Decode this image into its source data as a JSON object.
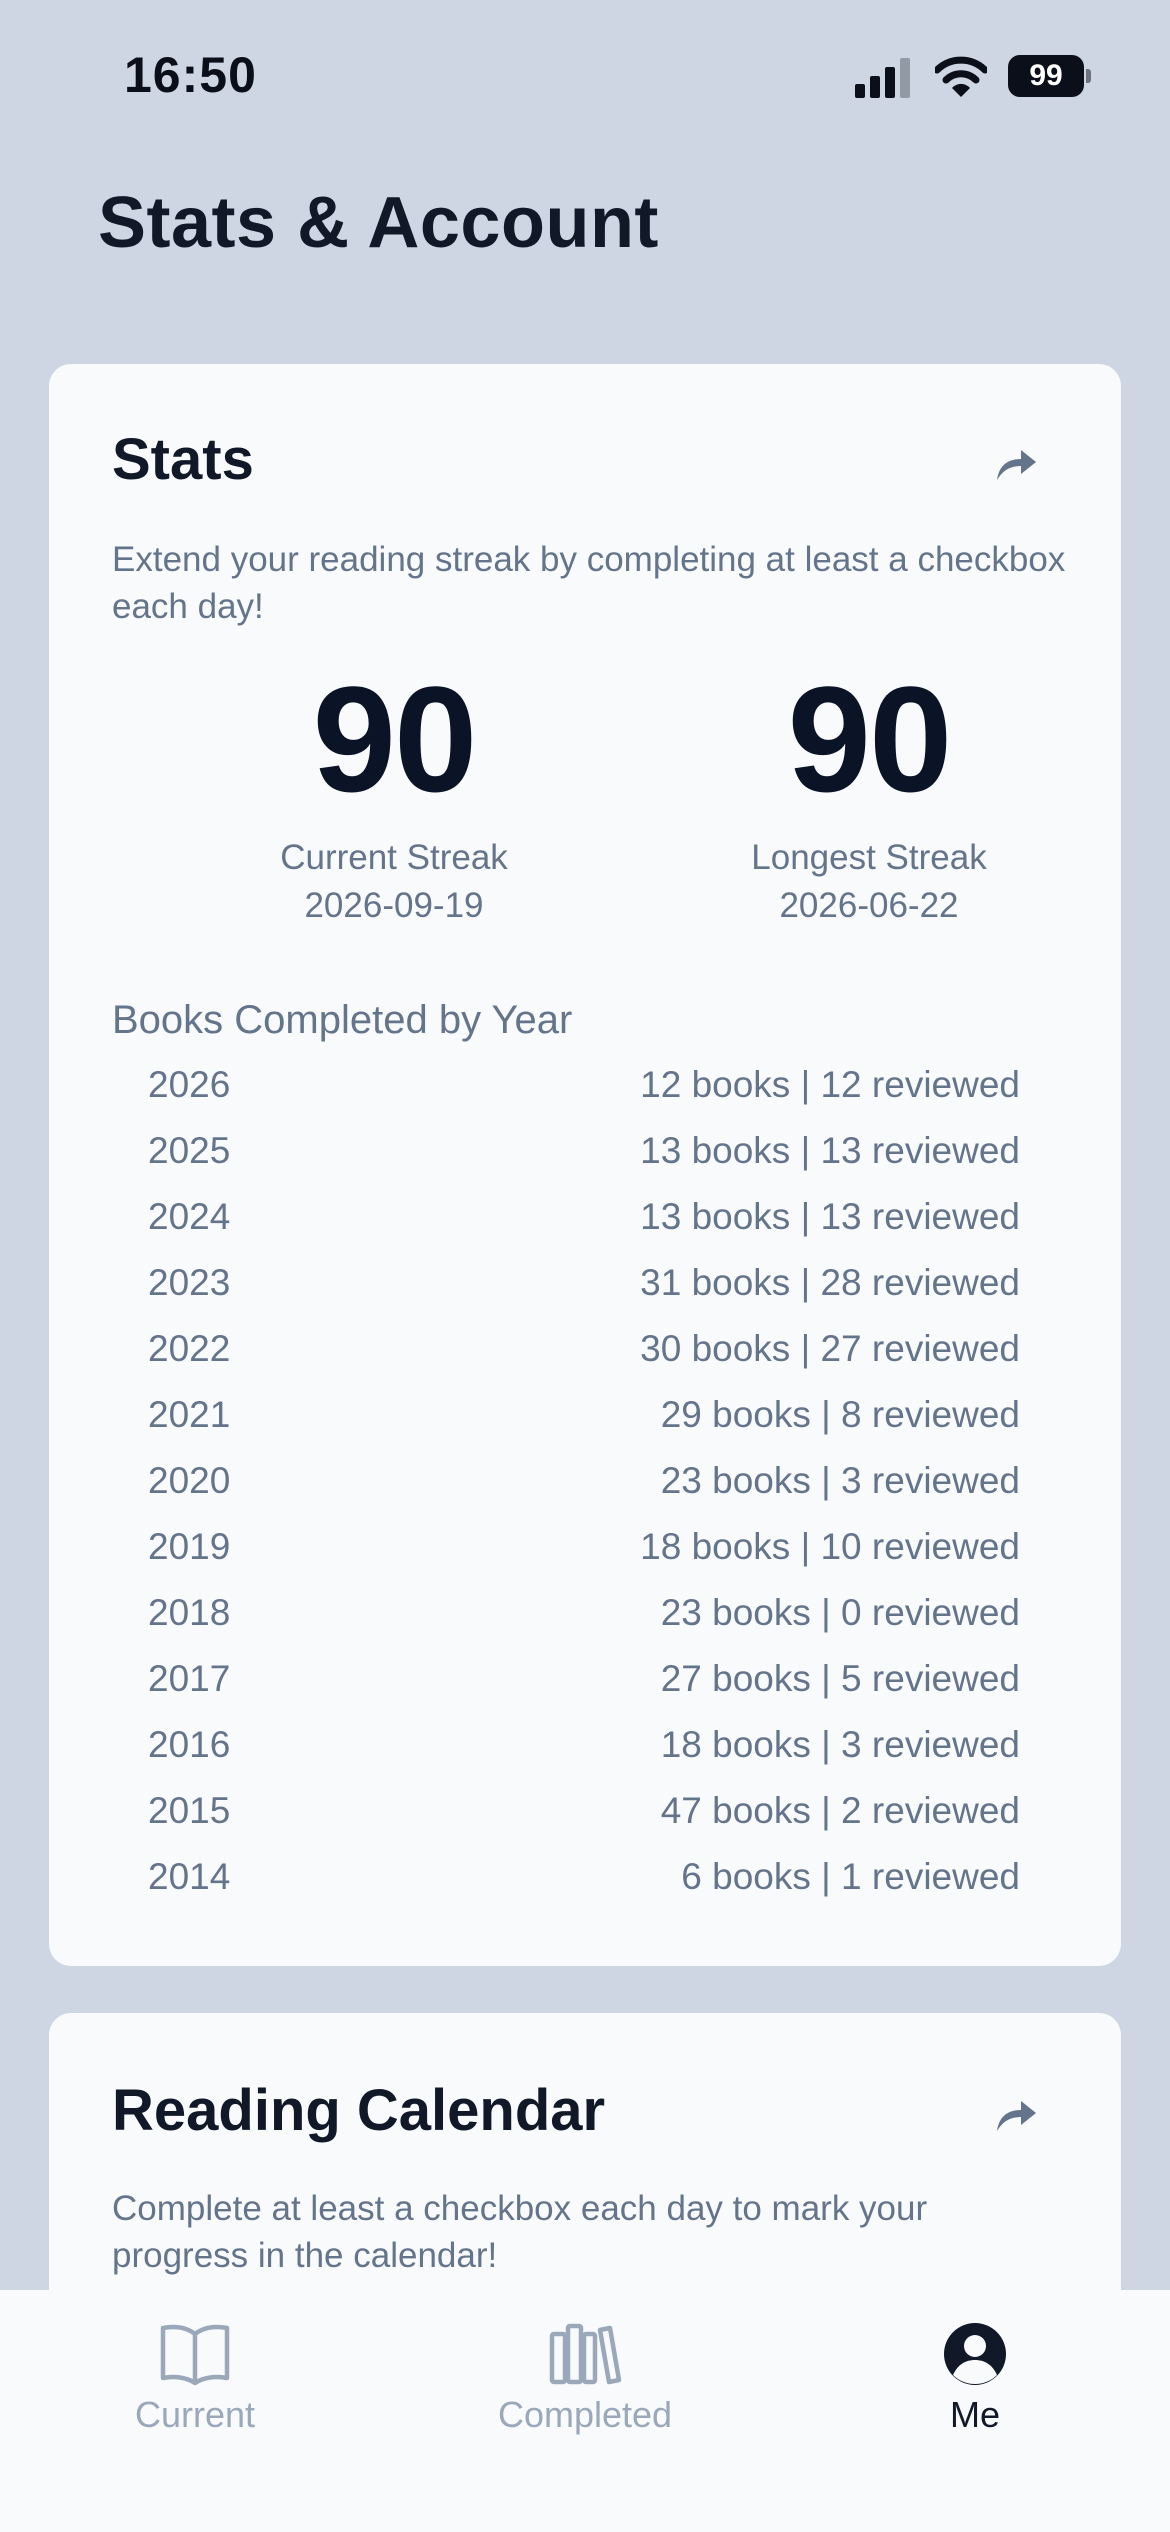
{
  "status": {
    "time": "16:50",
    "battery": "99"
  },
  "page": {
    "title": "Stats & Account"
  },
  "stats": {
    "title": "Stats",
    "description": "Extend your reading streak by completing at least a checkbox each day!",
    "current_streak": {
      "value": "90",
      "label": "Current Streak",
      "date": "2026-09-19"
    },
    "longest_streak": {
      "value": "90",
      "label": "Longest Streak",
      "date": "2026-06-22"
    },
    "years_title": "Books Completed by Year",
    "years": [
      {
        "year": "2026",
        "summary": "12 books | 12 reviewed"
      },
      {
        "year": "2025",
        "summary": "13 books | 13 reviewed"
      },
      {
        "year": "2024",
        "summary": "13 books | 13 reviewed"
      },
      {
        "year": "2023",
        "summary": "31 books | 28 reviewed"
      },
      {
        "year": "2022",
        "summary": "30 books | 27 reviewed"
      },
      {
        "year": "2021",
        "summary": "29 books | 8 reviewed"
      },
      {
        "year": "2020",
        "summary": "23 books | 3 reviewed"
      },
      {
        "year": "2019",
        "summary": "18 books | 10 reviewed"
      },
      {
        "year": "2018",
        "summary": "23 books | 0 reviewed"
      },
      {
        "year": "2017",
        "summary": "27 books | 5 reviewed"
      },
      {
        "year": "2016",
        "summary": "18 books | 3 reviewed"
      },
      {
        "year": "2015",
        "summary": "47 books | 2 reviewed"
      },
      {
        "year": "2014",
        "summary": "6 books | 1 reviewed"
      }
    ]
  },
  "calendar": {
    "title": "Reading Calendar",
    "description": "Complete at least a checkbox each day to mark your progress in the calendar!"
  },
  "tabs": [
    {
      "label": "Current",
      "icon": "open-book-icon",
      "active": false
    },
    {
      "label": "Completed",
      "icon": "bookshelf-icon",
      "active": false
    },
    {
      "label": "Me",
      "icon": "user-circle-icon",
      "active": true
    }
  ],
  "colors": {
    "background": "#cdd6e2",
    "card": "#f8fafc",
    "text": "#111827",
    "muted": "#64748b",
    "tab_inactive": "#9aa8ba"
  }
}
